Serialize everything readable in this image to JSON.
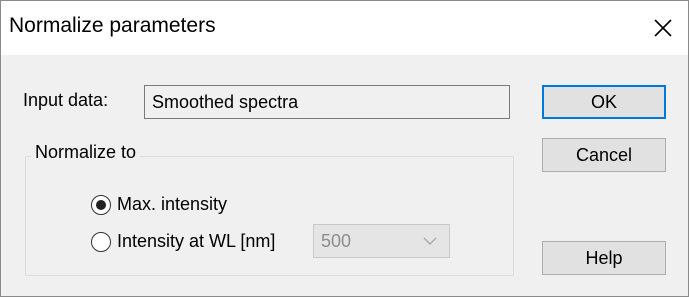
{
  "window": {
    "title": "Normalize parameters",
    "close_icon": "close-icon"
  },
  "input": {
    "label": "Input data:",
    "value": "Smoothed spectra"
  },
  "normalize": {
    "group_label": "Normalize to",
    "options": [
      {
        "label": "Max. intensity",
        "selected": true
      },
      {
        "label": "Intensity at WL [nm]",
        "selected": false
      }
    ],
    "wavelength": {
      "value": "500",
      "enabled": false,
      "arrow_icon": "chevron-down-icon"
    }
  },
  "buttons": {
    "ok": "OK",
    "cancel": "Cancel",
    "help": "Help"
  },
  "colors": {
    "dialog_bg": "#f0f0f0",
    "titlebar_bg": "#ffffff",
    "default_button_border": "#0078d7",
    "disabled_text": "#8d8d8d"
  }
}
